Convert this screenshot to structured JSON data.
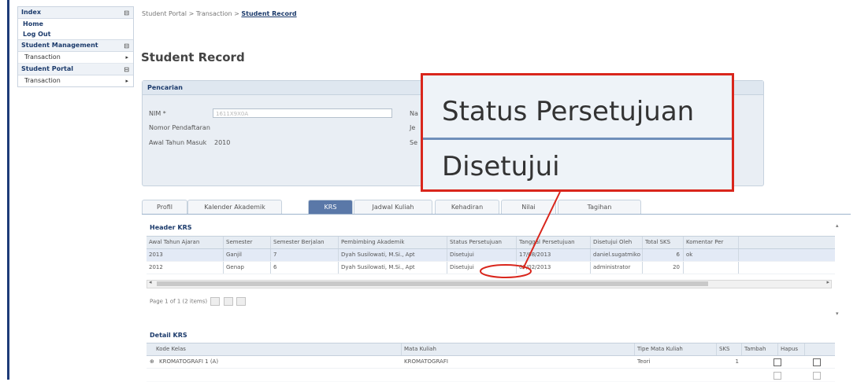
{
  "sidebar": {
    "sections": [
      {
        "title": "Index",
        "links": [
          "Home",
          "Log Out"
        ]
      },
      {
        "title": "Student Management",
        "items": [
          "Transaction"
        ]
      },
      {
        "title": "Student Portal",
        "items": [
          "Transaction"
        ]
      }
    ],
    "collapse_glyph": "⊟"
  },
  "breadcrumb": {
    "part1": "Student Portal",
    "part2": "Transaction",
    "current": "Student Record",
    "sep": ">"
  },
  "page_title": "Student Record",
  "search": {
    "title": "Pencarian",
    "nim_label": "NIM *",
    "nim_value": "1611X9X0A",
    "nomor_label": "Nomor Pendaftaran",
    "awal_label": "Awal Tahun Masuk",
    "awal_value": "2010",
    "right_labels": [
      "Na",
      "Je",
      "Se"
    ]
  },
  "tabs": [
    "Profil",
    "Kalender Akademik",
    "KRS",
    "Jadwal Kuliah",
    "Kehadiran",
    "Nilai",
    "Tagihan"
  ],
  "active_tab": "KRS",
  "header_krs": {
    "title": "Header KRS",
    "columns": [
      "Awal Tahun Ajaran",
      "Semester",
      "Semester Berjalan",
      "Pembimbing Akademik",
      "Status Persetujuan",
      "Tanggal Persetujuan",
      "Disetujui Oleh",
      "Total SKS",
      "Komentar Per"
    ],
    "rows": [
      [
        "2013",
        "Ganjil",
        "7",
        "Dyah Susilowati, M.Si., Apt",
        "Disetujui",
        "17/08/2013",
        "daniel.sugatmiko",
        "6",
        "ok"
      ],
      [
        "2012",
        "Genap",
        "6",
        "Dyah Susilowati, M.Si., Apt",
        "Disetujui",
        "07/02/2013",
        "administrator",
        "20",
        ""
      ]
    ]
  },
  "pager_text": "Page 1 of 1 (2 items)",
  "detail_krs": {
    "title": "Detail KRS",
    "columns": [
      "Kode Kelas",
      "Mata Kuliah",
      "Tipe Mata Kuliah",
      "SKS",
      "Tambah",
      "Hapus"
    ],
    "rows": [
      [
        "KROMATOGRAFI 1 (A)",
        "KROMATOGRAFI",
        "Teori",
        "1"
      ]
    ]
  },
  "callout": {
    "label": "Status Persetujuan",
    "value": "Disetujui"
  },
  "colors": {
    "accent": "#5a78a8",
    "callout_border": "#d9261c",
    "brand": "#1e3b78"
  }
}
